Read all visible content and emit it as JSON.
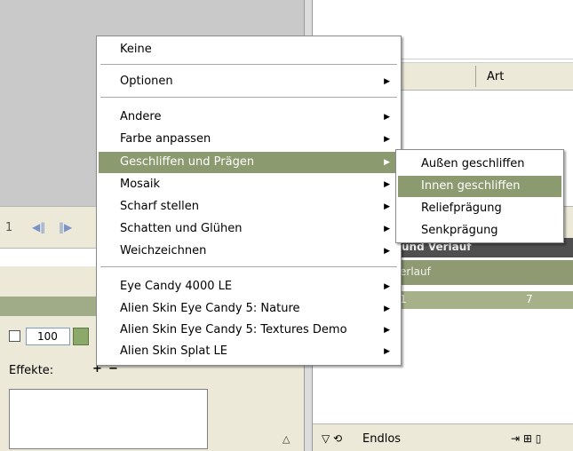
{
  "background": {
    "column_header": "Art",
    "frame_number": "1",
    "play_back_icon": "◀‖",
    "play_forward_icon": "‖▶",
    "panel_title_partial": "und Verlauf",
    "verlauf_label": "erlauf",
    "verlauf_row_left": "1",
    "verlauf_row_right": "7",
    "zoom_value": "100",
    "effekte_label": "Effekte:",
    "effekte_add": "+",
    "effekte_remove": "−",
    "bottom_loop_label": "Endlos",
    "triangle": "△"
  },
  "menu": {
    "items": [
      {
        "label": "Keine",
        "submenu": false
      },
      {
        "label": "Optionen",
        "submenu": true
      },
      {
        "label": "Andere",
        "submenu": true
      },
      {
        "label": "Farbe anpassen",
        "submenu": true
      },
      {
        "label": "Geschliffen und Prägen",
        "submenu": true,
        "highlighted": true
      },
      {
        "label": "Mosaik",
        "submenu": true
      },
      {
        "label": "Scharf stellen",
        "submenu": true
      },
      {
        "label": "Schatten und Glühen",
        "submenu": true
      },
      {
        "label": "Weichzeichnen",
        "submenu": true
      },
      {
        "label": "Eye Candy 4000 LE",
        "submenu": true
      },
      {
        "label": "Alien Skin Eye Candy 5: Nature",
        "submenu": true
      },
      {
        "label": "Alien Skin Eye Candy 5: Textures Demo",
        "submenu": true
      },
      {
        "label": "Alien Skin Splat LE",
        "submenu": true
      }
    ]
  },
  "submenu": {
    "items": [
      {
        "label": "Außen geschliffen"
      },
      {
        "label": "Innen geschliffen",
        "highlighted": true
      },
      {
        "label": "Reliefprägung"
      },
      {
        "label": "Senkprägung"
      }
    ]
  },
  "colors": {
    "highlight": "#8c9a70",
    "panel": "#ece9d8"
  }
}
